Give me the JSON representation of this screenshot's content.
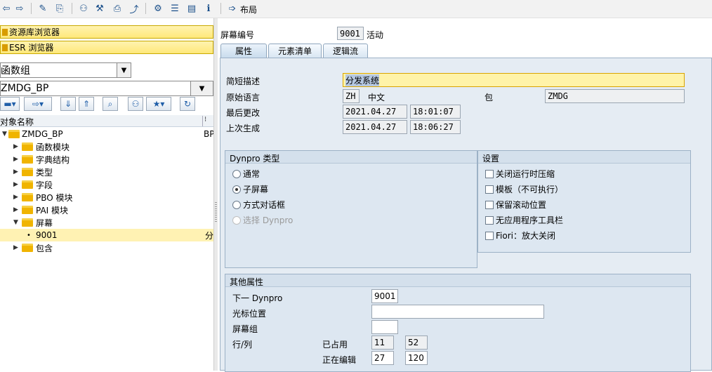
{
  "toolbar": {
    "layout_label": "布局"
  },
  "left": {
    "repo_browser": "资源库浏览器",
    "esr_browser": "ESR 浏览器",
    "object_type": "函数组",
    "object_name": "ZMDG_BP",
    "tree_header": "对象名称",
    "tree_header_col2": "BP",
    "tree": [
      {
        "label": "ZMDG_BP",
        "tail": "BP"
      },
      {
        "label": "函数模块"
      },
      {
        "label": "字典结构"
      },
      {
        "label": "类型"
      },
      {
        "label": "字段"
      },
      {
        "label": "PBO 模块"
      },
      {
        "label": "PAI 模块"
      },
      {
        "label": "屏幕"
      },
      {
        "label": "9001",
        "tail": "分"
      },
      {
        "label": "包含"
      }
    ]
  },
  "right": {
    "screen_no_label": "屏幕编号",
    "screen_no": "9001",
    "status": "活动",
    "tabs": [
      "属性",
      "元素清单",
      "逻辑流"
    ],
    "short_desc_label": "简短描述",
    "short_desc": "分发系统",
    "orig_lang_label": "原始语言",
    "orig_lang": "ZH",
    "orig_lang_text": "中文",
    "package_label": "包",
    "package": "ZMDG",
    "last_changed_label": "最后更改",
    "last_changed_date": "2021.04.27",
    "last_changed_time": "18:01:07",
    "last_gen_label": "上次生成",
    "last_gen_date": "2021.04.27",
    "last_gen_time": "18:06:27",
    "dynpro_type_title": "Dynpro 类型",
    "dynpro_types": [
      "通常",
      "子屏幕",
      "方式对话框",
      "选择 Dynpro"
    ],
    "settings_title": "设置",
    "settings": [
      "关闭运行时压缩",
      "模板（不可执行）",
      "保留滚动位置",
      "无应用程序工具栏",
      "Fiori：放大关闭"
    ],
    "other_title": "其他属性",
    "next_dynpro_label": "下一 Dynpro",
    "next_dynpro": "9001",
    "cursor_pos_label": "光标位置",
    "cursor_pos": "",
    "screen_group_label": "屏幕组",
    "screen_group": "",
    "row_col_label": "行/列",
    "occupied_label": "已占用",
    "occupied_row": "11",
    "occupied_col": "52",
    "editing_label": "正在编辑",
    "editing_row": "27",
    "editing_col": "120"
  }
}
